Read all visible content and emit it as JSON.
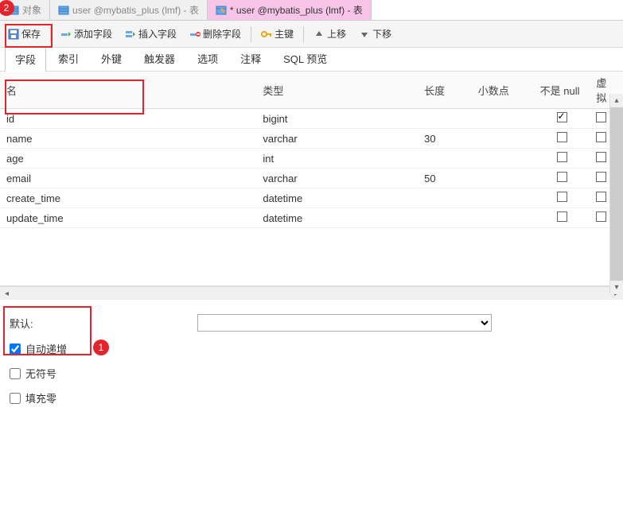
{
  "tabs": [
    {
      "label": "对象",
      "icon": "table-icon",
      "active": false
    },
    {
      "label": "user @mybatis_plus (lmf) - 表",
      "icon": "table-icon",
      "active": false
    },
    {
      "label": "* user @mybatis_plus (lmf) - 表",
      "icon": "table-design-icon",
      "active": true
    }
  ],
  "toolbar": {
    "save": "保存",
    "add_field": "添加字段",
    "insert_field": "插入字段",
    "delete_field": "删除字段",
    "primary_key": "主键",
    "move_up": "上移",
    "move_down": "下移"
  },
  "main_tabs": {
    "fields": "字段",
    "indexes": "索引",
    "foreign_keys": "外键",
    "triggers": "触发器",
    "options": "选项",
    "comment": "注释",
    "sql_preview": "SQL 预览"
  },
  "columns": {
    "name": "名",
    "type": "类型",
    "length": "长度",
    "decimals": "小数点",
    "not_null": "不是 null",
    "virtual": "虚拟"
  },
  "rows": [
    {
      "name": "id",
      "type": "bigint",
      "length": "",
      "decimals": "",
      "not_null": true
    },
    {
      "name": "name",
      "type": "varchar",
      "length": "30",
      "decimals": "",
      "not_null": false
    },
    {
      "name": "age",
      "type": "int",
      "length": "",
      "decimals": "",
      "not_null": false
    },
    {
      "name": "email",
      "type": "varchar",
      "length": "50",
      "decimals": "",
      "not_null": false
    },
    {
      "name": "create_time",
      "type": "datetime",
      "length": "",
      "decimals": "",
      "not_null": false
    },
    {
      "name": "update_time",
      "type": "datetime",
      "length": "",
      "decimals": "",
      "not_null": false
    }
  ],
  "bottom": {
    "default_label": "默认:",
    "auto_increment": "自动递增",
    "unsigned": "无符号",
    "zerofill": "填充零"
  },
  "annotations": {
    "badge1": "1",
    "badge2": "2"
  }
}
